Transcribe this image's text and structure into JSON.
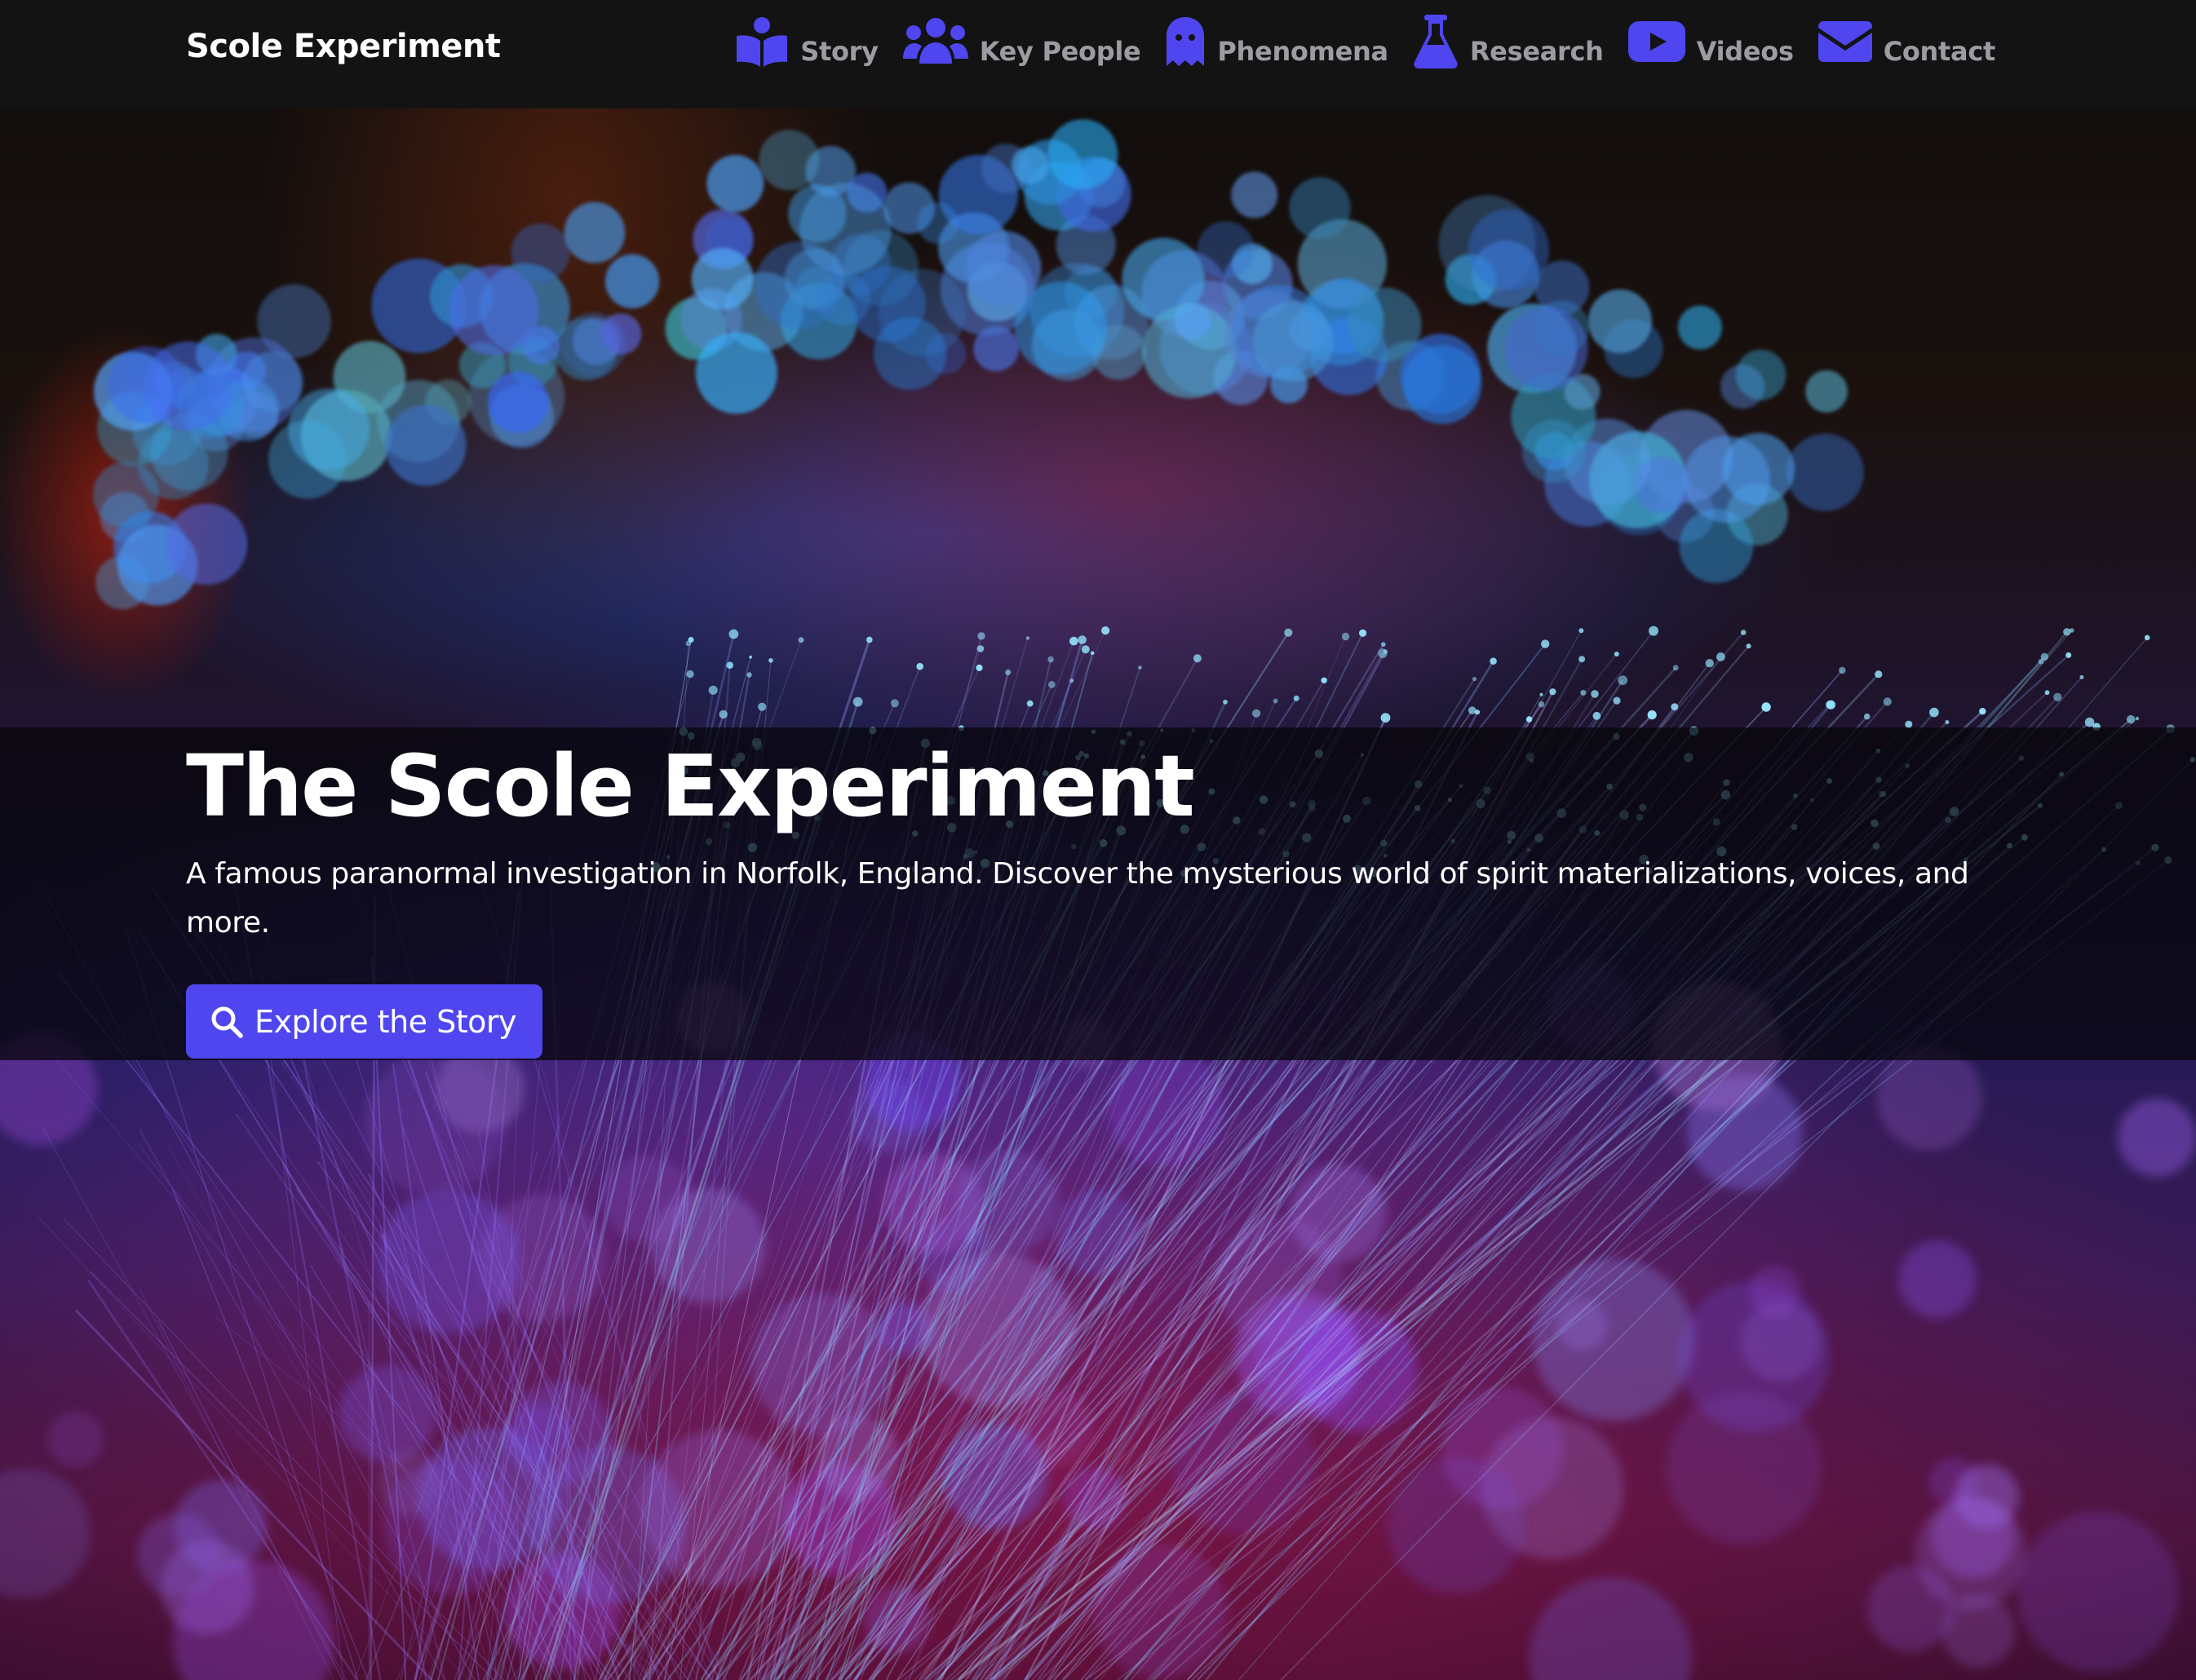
{
  "navbar": {
    "brand": "Scole Experiment",
    "items": [
      {
        "label": "Story",
        "icon": "book-reader-icon"
      },
      {
        "label": "Key People",
        "icon": "users-icon"
      },
      {
        "label": "Phenomena",
        "icon": "ghost-icon"
      },
      {
        "label": "Research",
        "icon": "flask-icon"
      },
      {
        "label": "Videos",
        "icon": "youtube-icon"
      },
      {
        "label": "Contact",
        "icon": "envelope-icon"
      }
    ]
  },
  "hero": {
    "title": "The Scole Experiment",
    "subtitle": "A famous paranormal investigation in Norfolk, England. Discover the mysterious world of spirit materializations, voices, and more.",
    "cta_label": "Explore the Story",
    "cta_icon": "search-icon"
  },
  "colors": {
    "accent": "#4f46f0",
    "navbar_bg": "#131314",
    "nav_text": "#9c9ca3",
    "text": "#ffffff"
  }
}
